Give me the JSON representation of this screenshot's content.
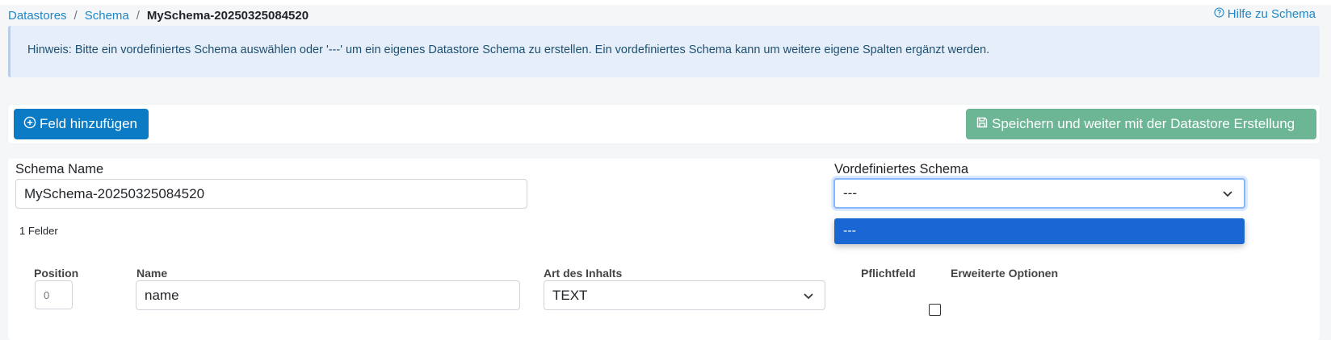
{
  "breadcrumb": {
    "items": [
      "Datastores",
      "Schema"
    ],
    "separator": "/",
    "current": "MySchema-20250325084520"
  },
  "help": {
    "label": "Hilfe zu Schema",
    "icon": "question-circle-icon"
  },
  "alert": {
    "text": "Hinweis: Bitte ein vordefiniertes Schema auswählen oder '---' um ein eigenes Datastore Schema zu erstellen. Ein vordefiniertes Schema kann um weitere eigene Spalten ergänzt werden."
  },
  "toolbar": {
    "add_label": "Feld hinzufügen",
    "add_icon": "plus-circle-icon",
    "save_label": "Speichern und weiter mit der Datastore Erstellung",
    "save_icon": "floppy-disk-icon"
  },
  "form": {
    "schema_name_label": "Schema Name",
    "schema_name_value": "MySchema-20250325084520",
    "predefined_label": "Vordefiniertes Schema",
    "predefined_value": "---",
    "predefined_options": [
      "---"
    ],
    "felder_count": "1 Felder"
  },
  "table": {
    "headers": {
      "position": "Position",
      "name": "Name",
      "art": "Art des Inhalts",
      "pflicht": "Pflichtfeld",
      "erweitert": "Erweiterte Optionen"
    },
    "rows": [
      {
        "position": "0",
        "name": "name",
        "art": "TEXT",
        "pflicht": false
      }
    ]
  },
  "colors": {
    "primary": "#0a7bc4",
    "success_muted": "#6cb595",
    "link": "#1f87c8",
    "alert_bg": "#e6eff9",
    "dropdown_highlight": "#1a66d2"
  }
}
